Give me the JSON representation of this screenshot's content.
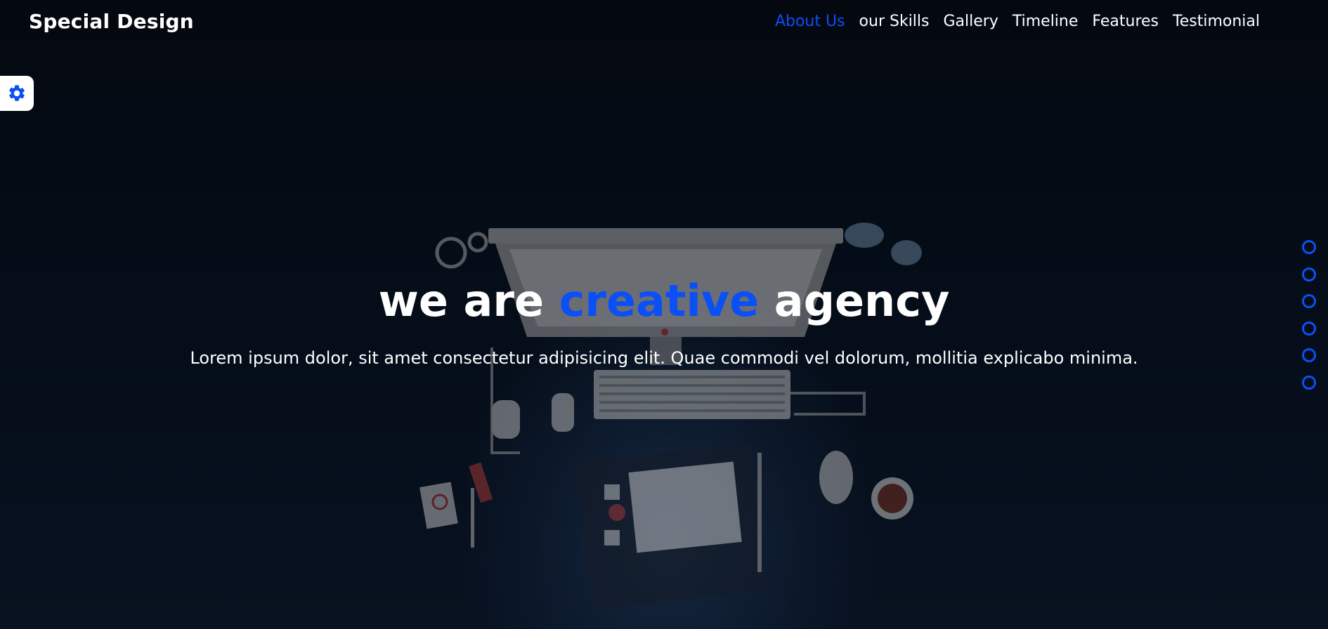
{
  "brand": {
    "logo": "Special Design"
  },
  "nav": {
    "items": [
      {
        "label": "About Us",
        "active": true
      },
      {
        "label": "our Skills",
        "active": false
      },
      {
        "label": "Gallery",
        "active": false
      },
      {
        "label": "Timeline",
        "active": false
      },
      {
        "label": "Features",
        "active": false
      },
      {
        "label": "Testimonial",
        "active": false
      }
    ]
  },
  "settings": {
    "icon": "gear-icon"
  },
  "hero": {
    "title_part1": "we are",
    "title_accent": "creative",
    "title_part2": "agency",
    "subtitle": "Lorem ipsum dolor, sit amet consectetur adipisicing elit. Quae commodi vel dolorum, mollitia explicabo minima."
  },
  "bullets": {
    "count": 6
  },
  "colors": {
    "accent": "#0b4ff6",
    "background": "#050c17",
    "text": "#ffffff"
  }
}
